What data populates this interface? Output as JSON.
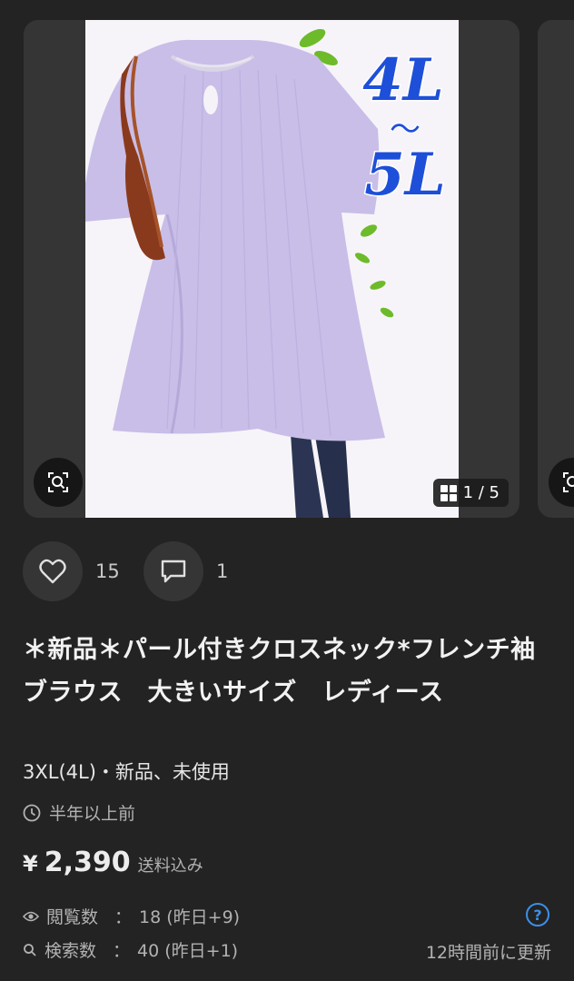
{
  "gallery": {
    "overlay_text": [
      "4L",
      "～",
      "5L"
    ],
    "counter": "1 / 5",
    "colors": {
      "blouse": "#c8bce8",
      "overlay_text": "#1e4fd8"
    },
    "icons": {
      "zoom": "zoom-search-icon",
      "grid": "grid-icon"
    }
  },
  "actions": {
    "likes": "15",
    "comments": "1",
    "icons": {
      "like": "heart-icon",
      "comment": "comment-icon"
    }
  },
  "item": {
    "title": "＊新品＊パール付きクロスネック*フレンチ袖ブラウス　大きいサイズ　レディース",
    "condition": "3XL(4L)・新品、未使用",
    "listed": "半年以上前",
    "price_symbol": "¥",
    "price": "2,390",
    "shipping": "送料込み"
  },
  "stats": {
    "views_label": "閲覧数",
    "views_value": "18 (昨日+9)",
    "searches_label": "検索数",
    "searches_value": "40 (昨日+1)",
    "colon": "：",
    "updated": "12時間前に更新",
    "help_label": "?",
    "colors": {
      "help": "#3d8fe8"
    }
  }
}
